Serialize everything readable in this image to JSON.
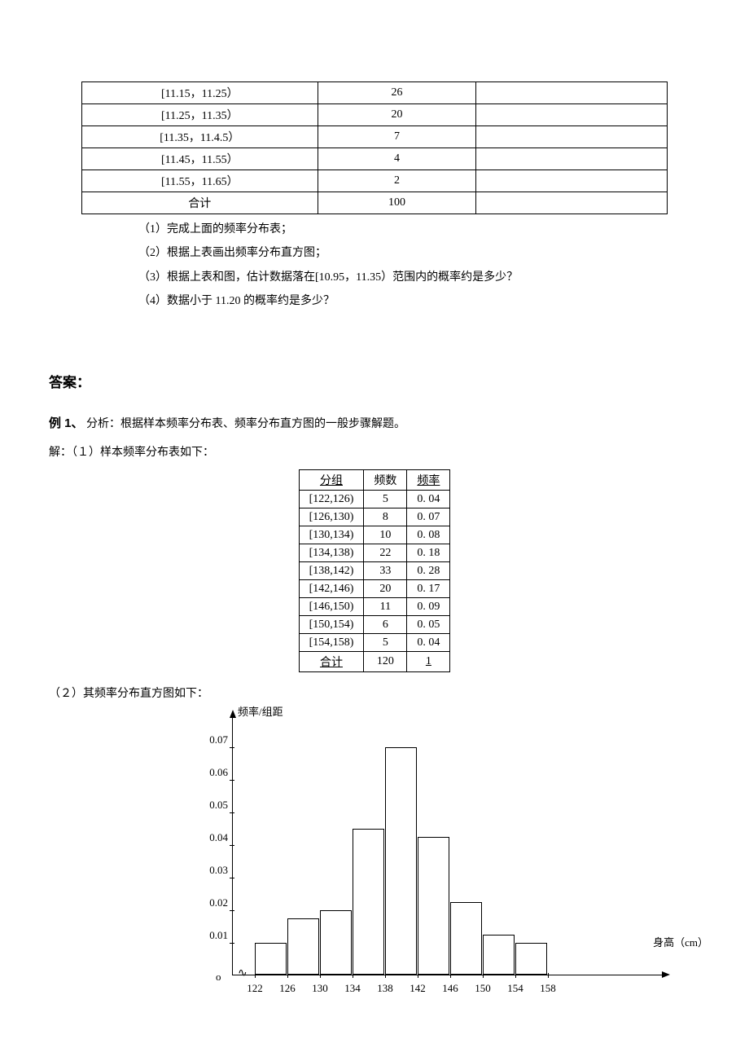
{
  "top_table": {
    "rows": [
      {
        "r": "[11.15，11.25）",
        "c": "26",
        "e": ""
      },
      {
        "r": "[11.25，11.35）",
        "c": "20",
        "e": ""
      },
      {
        "r": "[11.35，11.4.5）",
        "c": "7",
        "e": ""
      },
      {
        "r": "[11.45，11.55）",
        "c": "4",
        "e": ""
      },
      {
        "r": "[11.55，11.65）",
        "c": "2",
        "e": ""
      },
      {
        "r": "合计",
        "c": "100",
        "e": ""
      }
    ]
  },
  "questions": {
    "q1": "（1）完成上面的频率分布表；",
    "q2": "（2）根据上表画出频率分布直方图；",
    "q3": "（3）根据上表和图，估计数据落在[10.95，11.35）范围内的概率约是多少？",
    "q4": "（4）数据小于 11.20 的概率约是多少？"
  },
  "answer": {
    "heading": "答案：",
    "example": "例 1、",
    "analysis": "分析：根据样本频率分布表、频率分布直方图的一般步骤解题。",
    "solution_prefix": "解：（１）样本频率分布表如下："
  },
  "freq_table": {
    "head": {
      "a": "分组",
      "b": "频数",
      "c": "频率"
    },
    "rows": [
      {
        "a": "[122,126)",
        "b": "5",
        "c": "0. 04"
      },
      {
        "a": "[126,130)",
        "b": "8",
        "c": "0. 07"
      },
      {
        "a": "[130,134)",
        "b": "10",
        "c": "0. 08"
      },
      {
        "a": "[134,138)",
        "b": "22",
        "c": "0. 18"
      },
      {
        "a": "[138,142)",
        "b": "33",
        "c": "0. 28"
      },
      {
        "a": "[142,146)",
        "b": "20",
        "c": "0. 17"
      },
      {
        "a": "[146,150)",
        "b": "11",
        "c": "0. 09"
      },
      {
        "a": "[150,154)",
        "b": "6",
        "c": "0. 05"
      },
      {
        "a": "[154,158)",
        "b": "5",
        "c": "0. 04"
      },
      {
        "a": "合计",
        "b": "120",
        "c": "1"
      }
    ]
  },
  "chart_caption": "（２）其频率分布直方图如下：",
  "chart_data": {
    "type": "bar",
    "title": "",
    "xlabel": "身高（cm）",
    "ylabel": "频率/组距",
    "categories": [
      "122",
      "126",
      "130",
      "134",
      "138",
      "142",
      "146",
      "150",
      "154",
      "158"
    ],
    "values": [
      0.01,
      0.0175,
      0.02,
      0.045,
      0.07,
      0.0425,
      0.0225,
      0.0125,
      0.01
    ],
    "y_ticks": [
      0.01,
      0.02,
      0.03,
      0.04,
      0.05,
      0.06,
      0.07
    ],
    "ylim": [
      0,
      0.075
    ],
    "origin_label": "o"
  }
}
